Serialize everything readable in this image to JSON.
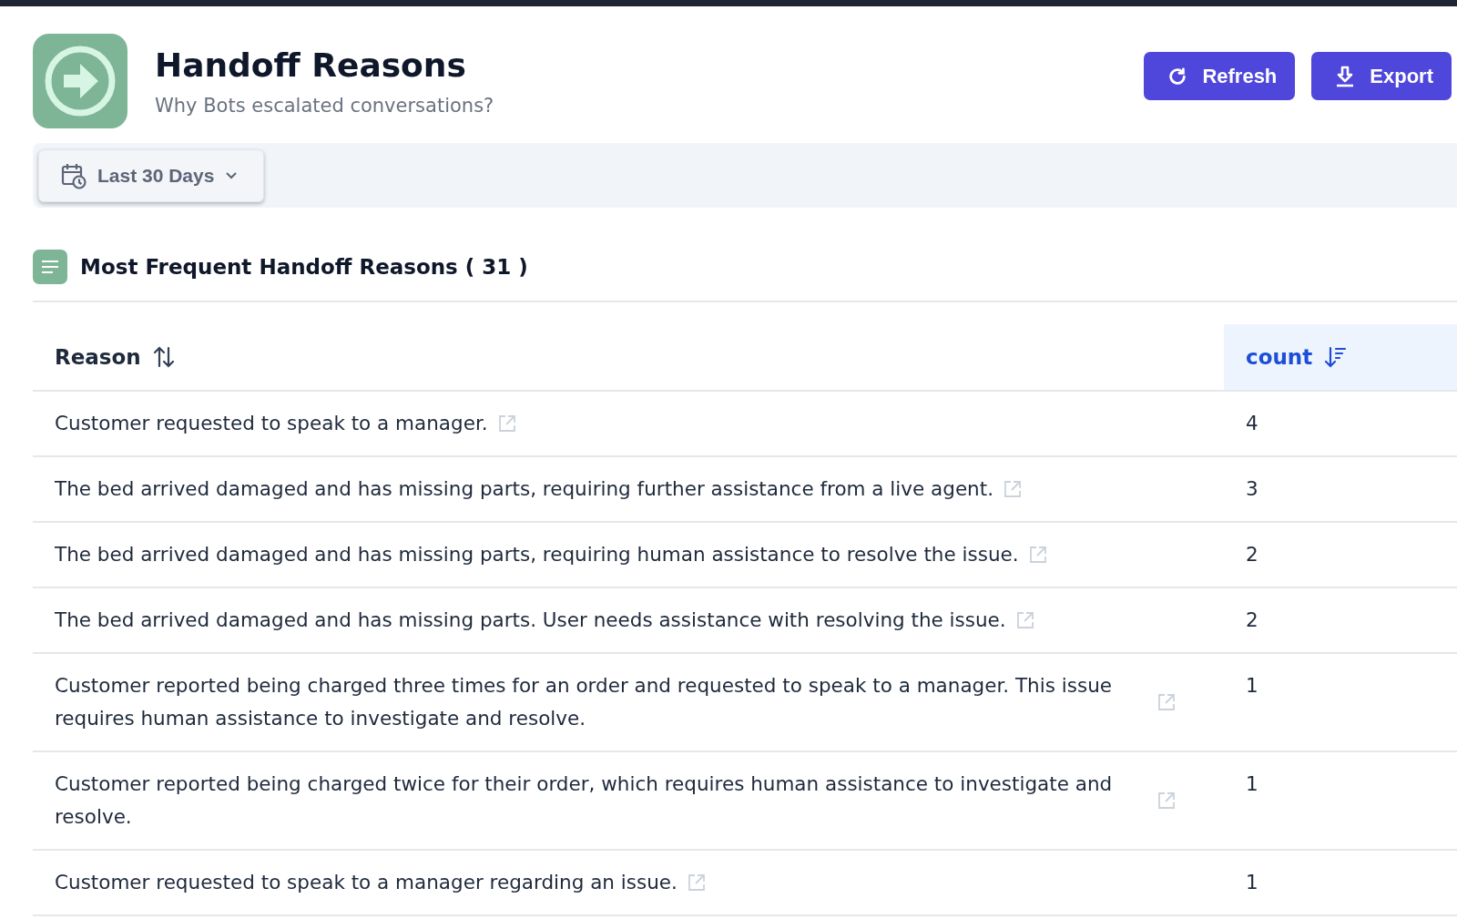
{
  "header": {
    "title": "Handoff Reasons",
    "subtitle": "Why Bots escalated conversations?",
    "buttons": [
      {
        "kind": "refresh",
        "label": "Refresh"
      },
      {
        "kind": "export",
        "label": "Export"
      }
    ]
  },
  "filter": {
    "date_range": "Last 30 Days"
  },
  "section": {
    "title": "Most Frequent Handoff Reasons ( 31 )"
  },
  "table": {
    "columns": [
      {
        "label": "Reason",
        "selected": false
      },
      {
        "label": "count",
        "selected": true
      }
    ],
    "rows": [
      {
        "reason": "Customer requested to speak to a manager.",
        "count": "4"
      },
      {
        "reason": "The bed arrived damaged and has missing parts, requiring further assistance from a live agent.",
        "count": "3"
      },
      {
        "reason": "The bed arrived damaged and has missing parts, requiring human assistance to resolve the issue.",
        "count": "2"
      },
      {
        "reason": "The bed arrived damaged and has missing parts. User needs assistance with resolving the issue.",
        "count": "2"
      },
      {
        "reason": "Customer reported being charged three times for an order and requested to speak to a manager. This issue requires human assistance to investigate and resolve.",
        "count": "1"
      },
      {
        "reason": "Customer reported being charged twice for their order, which requires human assistance to investigate and resolve.",
        "count": "1"
      },
      {
        "reason": "Customer requested to speak to a manager regarding an issue.",
        "count": "1"
      }
    ]
  }
}
